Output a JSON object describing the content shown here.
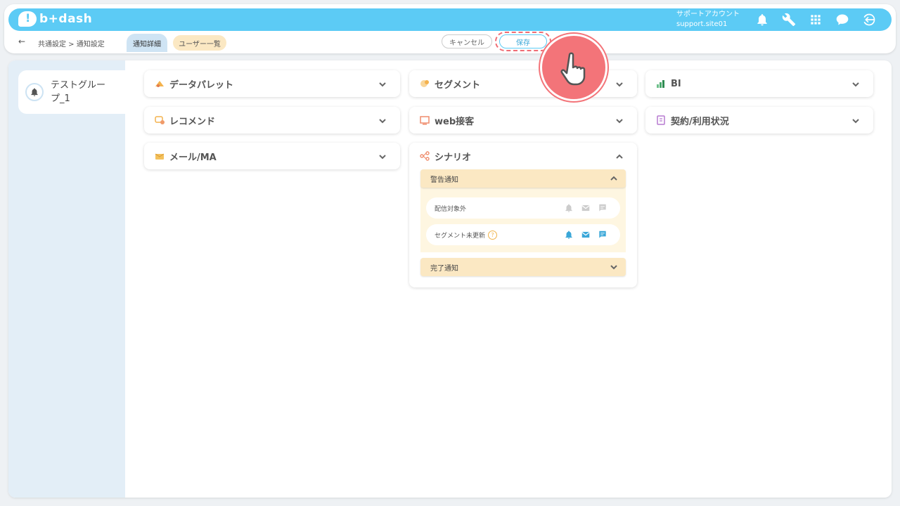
{
  "header": {
    "logo_text": "b+dash",
    "account_label": "サポートアカウント",
    "account_id": "support.site01"
  },
  "subbar": {
    "back": "←",
    "breadcrumb": "共通設定 > 通知設定",
    "tabs": [
      "通知詳細",
      "ユーザー一覧"
    ],
    "cancel_label": "キャンセル",
    "save_label": "保存"
  },
  "sidebar": {
    "group_name": "テストグループ_1"
  },
  "categories": {
    "data_palette": "データパレット",
    "segment": "セグメント",
    "bi": "BI",
    "recommend": "レコメンド",
    "web": "web接客",
    "contract": "契約/利用状況",
    "mail": "メール/MA",
    "scenario": "シナリオ"
  },
  "scenario": {
    "warning_title": "警告通知",
    "rows": [
      {
        "label": "配信対象外",
        "active": false
      },
      {
        "label": "セグメント未更新",
        "active": true,
        "help": "?"
      }
    ],
    "complete_title": "完了通知"
  },
  "colors": {
    "brand": "#5ccbf5",
    "highlight": "#f37479",
    "tab_active": "#cfe4f4",
    "tab_inactive": "#fbe8c3"
  }
}
